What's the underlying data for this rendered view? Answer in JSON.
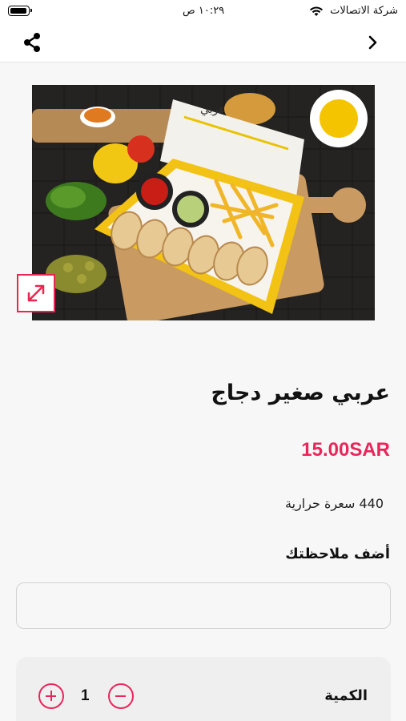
{
  "status_bar": {
    "carrier": "شركة الاتصالات",
    "time": "١٠:٢٩ ص"
  },
  "nav": {
    "share_icon": "share-icon",
    "back_icon": "chevron-right-icon"
  },
  "product": {
    "title": "عربي صغير دجاج",
    "price": "15.00SAR",
    "calories": "440 سعرة حرارية",
    "note_label": "أضف ملاحظتك",
    "note_value": "",
    "image_box_text": "عربي",
    "quantity_label": "الكمية",
    "quantity_value": "1"
  },
  "colors": {
    "accent": "#e8265b",
    "background": "#f7f7f7"
  }
}
